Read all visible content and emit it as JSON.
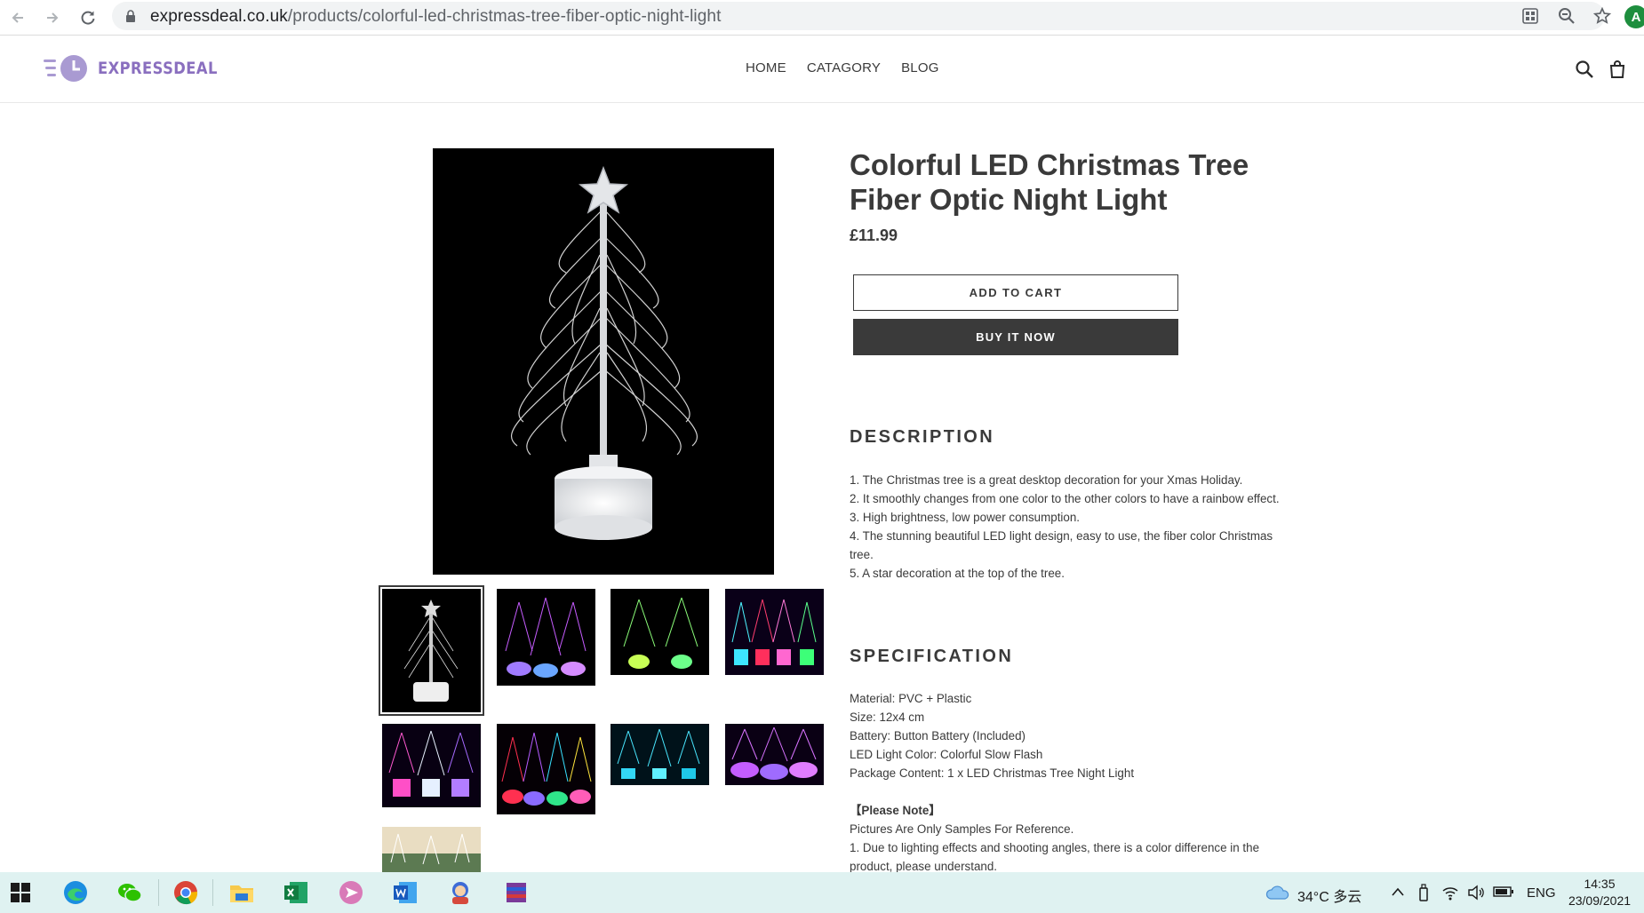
{
  "browser": {
    "url_host": "expressdeal.co.uk",
    "url_path": "/products/colorful-led-christmas-tree-fiber-optic-night-light",
    "profile_initial": "A"
  },
  "header": {
    "logo_text": "EXPRESSDEAL",
    "nav": [
      "HOME",
      "CATAGORY",
      "BLOG"
    ]
  },
  "product": {
    "title": "Colorful LED Christmas Tree Fiber Optic Night Light",
    "price": "£11.99",
    "add_to_cart": "ADD TO CART",
    "buy_now": "BUY IT NOW",
    "description_heading": "DESCRIPTION",
    "description": [
      "1. The Christmas tree is a great desktop decoration for your Xmas Holiday.",
      "2. It smoothly changes from one color to the other colors to have a rainbow effect.",
      "3. High brightness, low power consumption.",
      "4. The stunning beautiful LED light design, easy to use, the fiber color Christmas tree.",
      "5. A star decoration at the top of the tree."
    ],
    "specification_heading": "SPECIFICATION",
    "specification": [
      "Material: PVC + Plastic",
      "Size: 12x4 cm",
      "Battery: Button Battery (Included)",
      "LED Light Color: Colorful Slow Flash",
      "Package Content: 1 x LED Christmas Tree Night Light"
    ],
    "note_heading": "【Please Note】",
    "notes": [
      "Pictures Are Only Samples For Reference.",
      "1. Due to lighting effects and shooting angles, there is a color difference in the product, please understand."
    ]
  },
  "taskbar": {
    "weather": "34°C 多云",
    "language": "ENG",
    "time": "14:35",
    "date": "23/09/2021"
  }
}
